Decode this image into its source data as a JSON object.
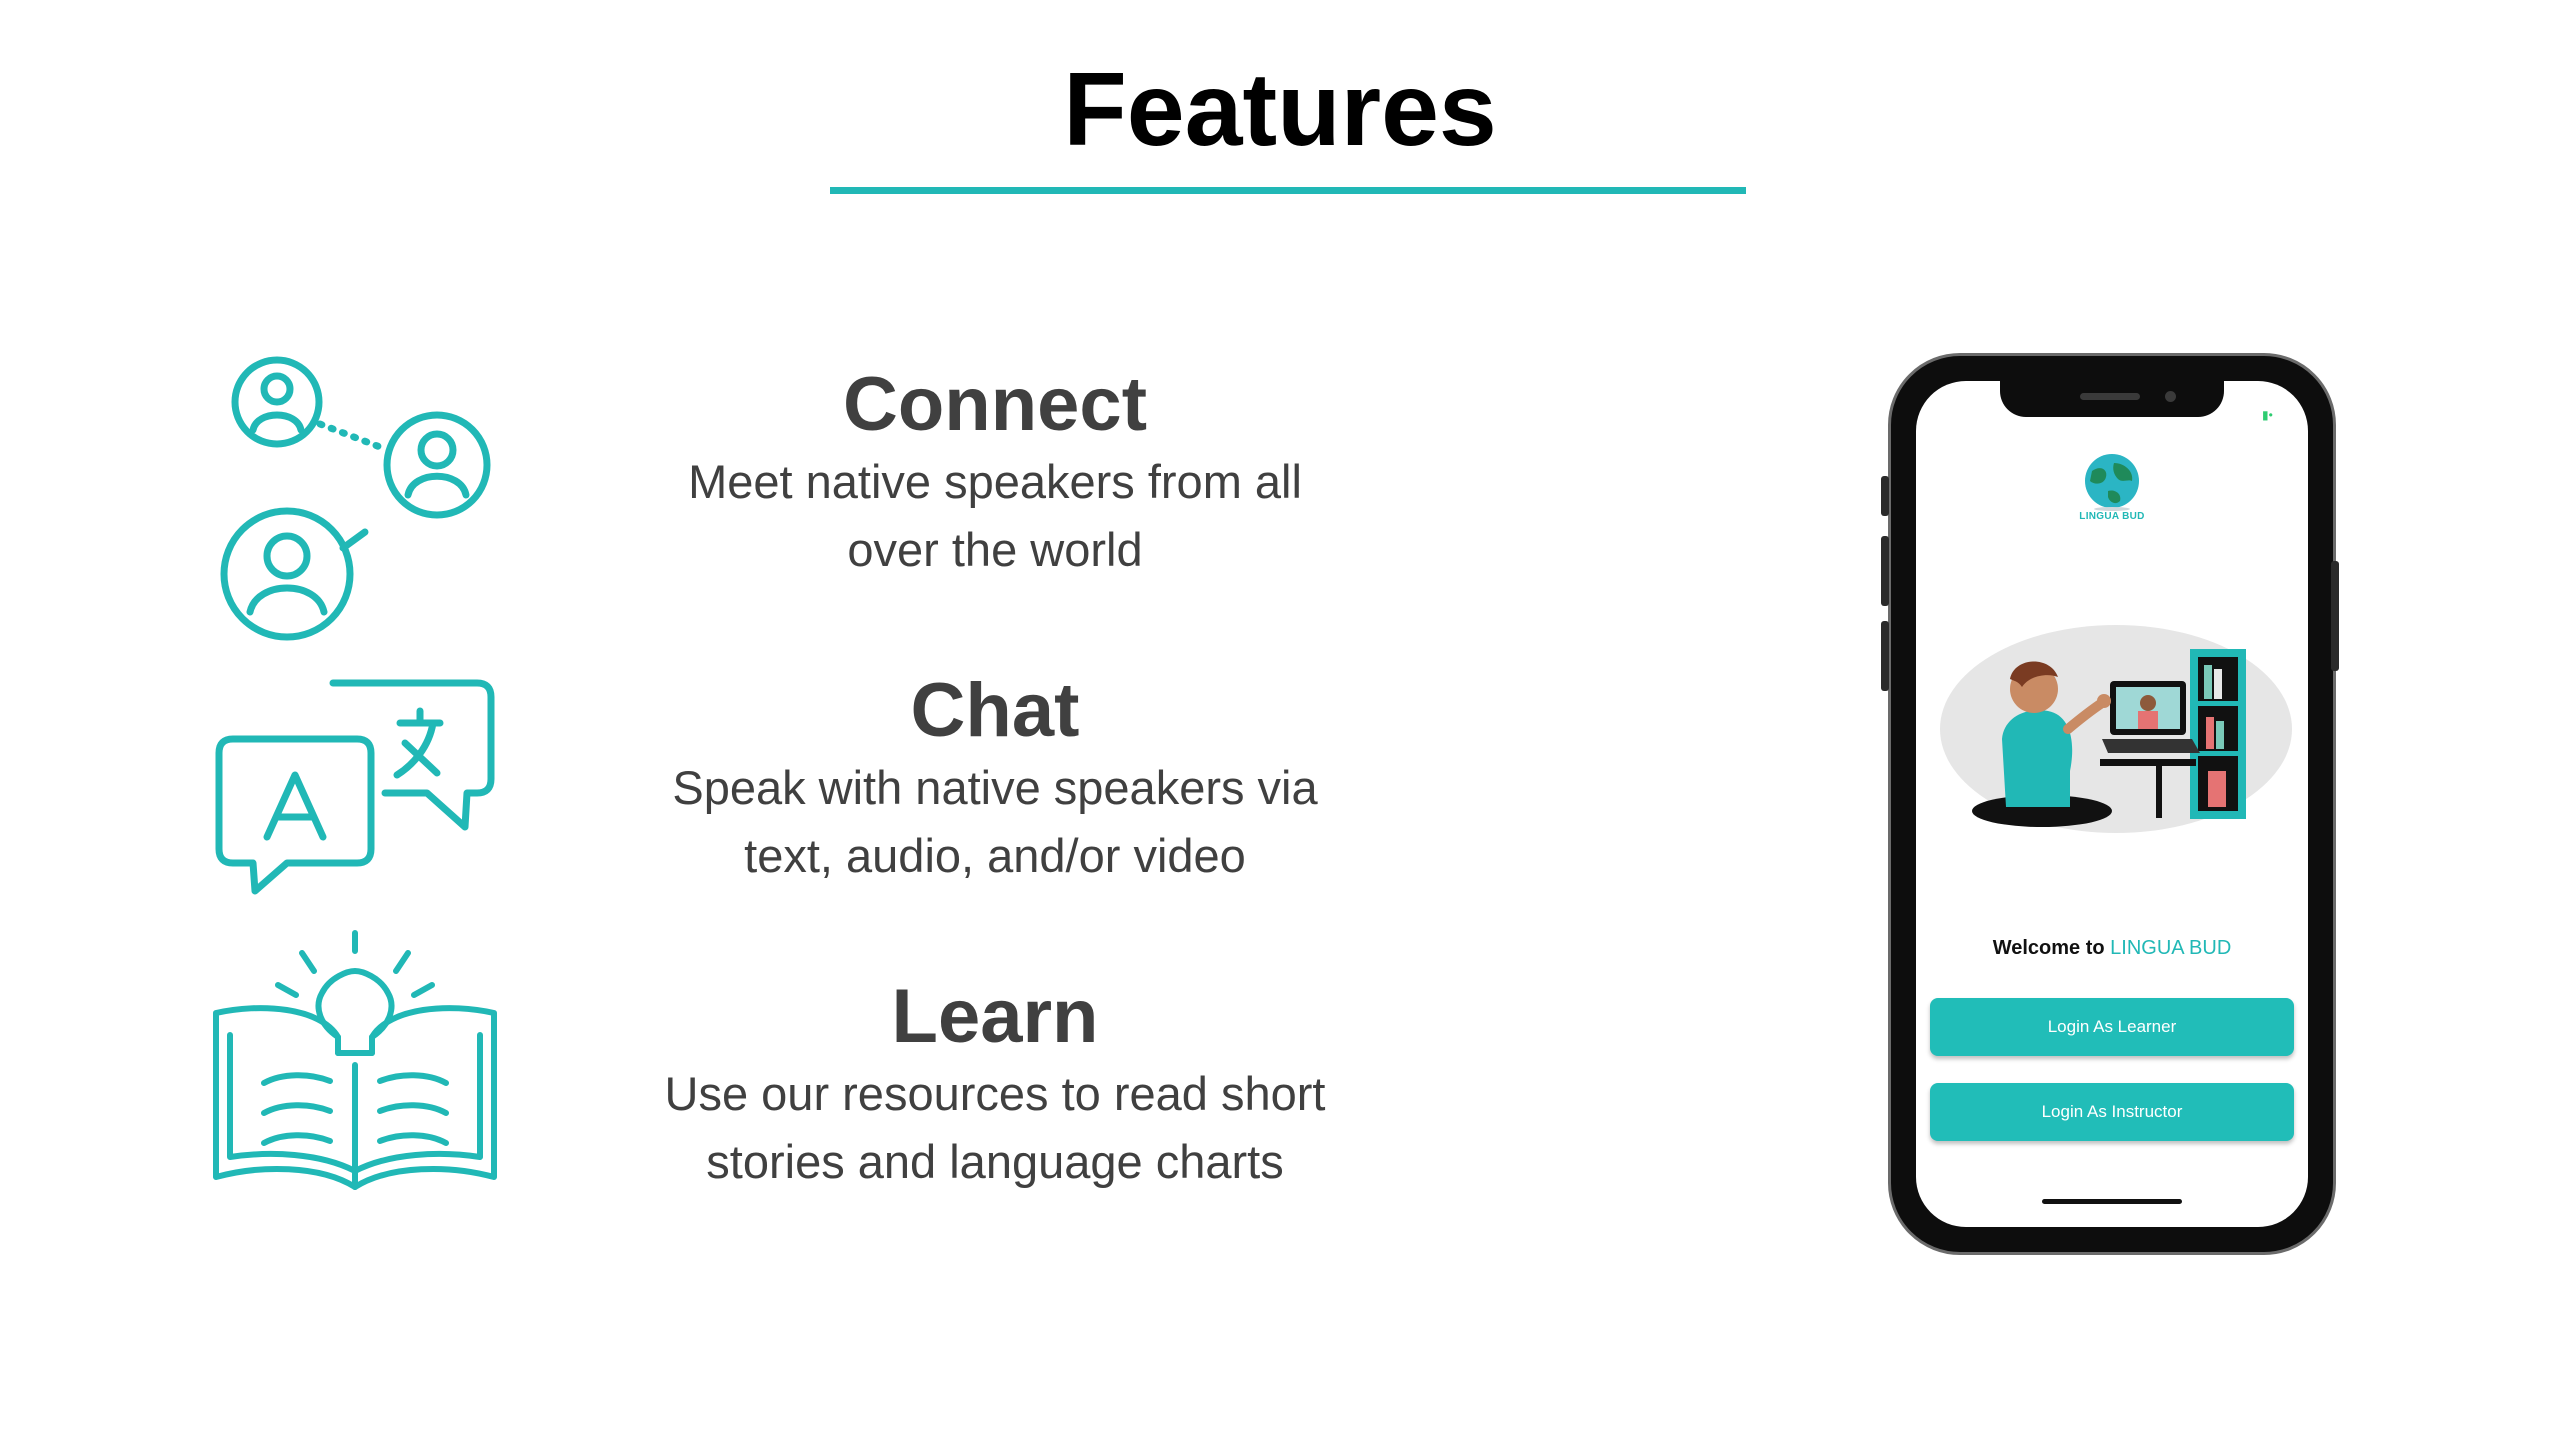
{
  "slide": {
    "title": "Features",
    "accent_color": "#21b8b6"
  },
  "features": [
    {
      "icon": "people-network-icon",
      "title": "Connect",
      "line1": "Meet native speakers from all",
      "line2": "over the world"
    },
    {
      "icon": "translate-chat-icon",
      "title": "Chat",
      "line1": "Speak with native speakers via",
      "line2": "text, audio, and/or video"
    },
    {
      "icon": "book-lightbulb-icon",
      "title": "Learn",
      "line1": "Use our resources to read short",
      "line2": "stories and language charts"
    }
  ],
  "phone": {
    "app_name": "LINGUA BUD",
    "logo_icon": "globe-icon",
    "welcome_prefix": "Welcome to",
    "welcome_brand": "LINGUA BUD",
    "buttons": [
      {
        "label": "Login As Learner"
      },
      {
        "label": "Login As Instructor"
      }
    ]
  }
}
